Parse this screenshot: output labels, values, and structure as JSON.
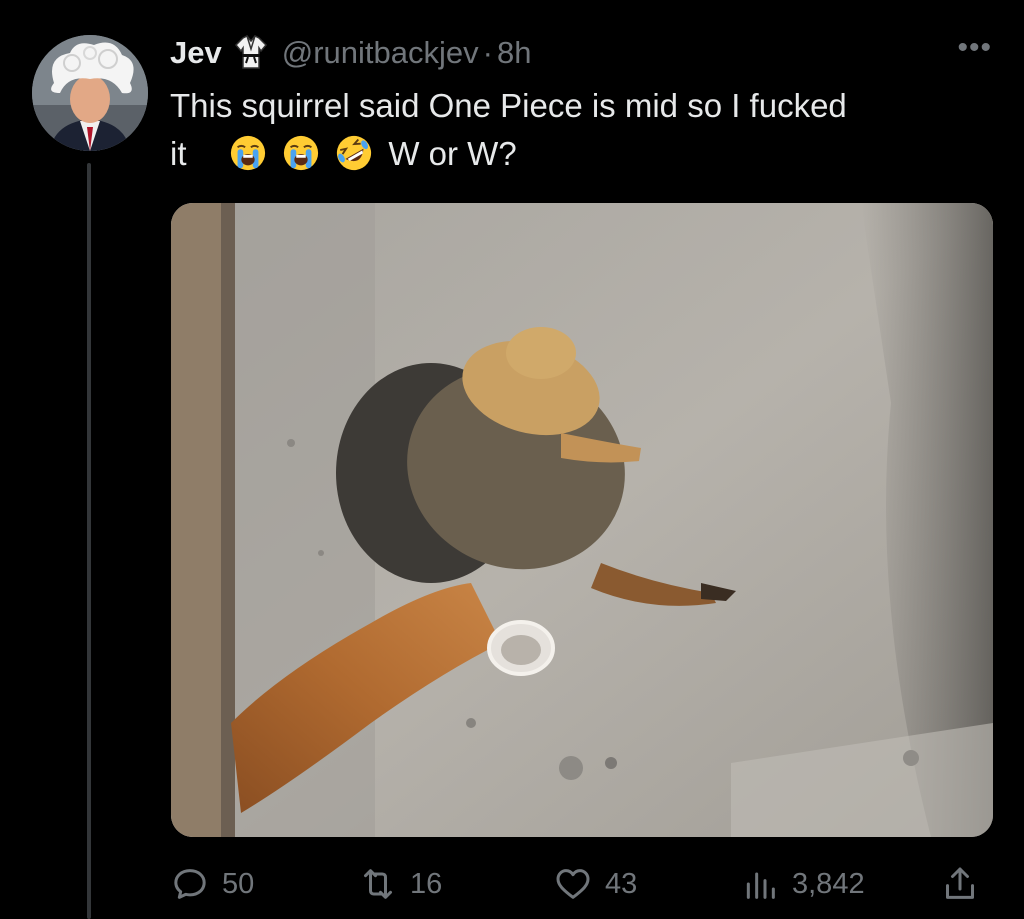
{
  "tweet": {
    "display_name": "Jev",
    "handle": "@runitbackjev",
    "separator": "·",
    "time": "8h",
    "more_label": "•••",
    "text_line1": "This squirrel said One Piece is mid so I fucked",
    "text_line2_start": "it",
    "text_line2_end": "W or W?",
    "emojis": [
      "loudly-crying-face",
      "loudly-crying-face",
      "rolling-on-floor-laughing"
    ]
  },
  "actions": {
    "replies": "50",
    "reposts": "16",
    "likes": "43",
    "views": "3,842"
  },
  "colors": {
    "background": "#000000",
    "text": "#e7e9ea",
    "muted": "#71767b",
    "thread_line": "#333639"
  }
}
